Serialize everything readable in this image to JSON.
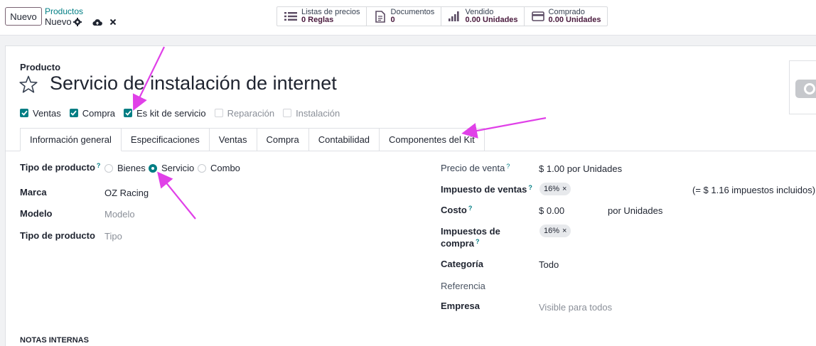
{
  "topbar": {
    "new_button": "Nuevo",
    "breadcrumb": "Productos",
    "record": "Nuevo"
  },
  "smart_buttons": [
    {
      "label": "Listas de precios",
      "value": "0  Reglas",
      "icon": "list-icon"
    },
    {
      "label": "Documentos",
      "value": "0",
      "icon": "document-icon"
    },
    {
      "label": "Vendido",
      "value": "0.00 Unidades",
      "icon": "bar-chart-icon"
    },
    {
      "label": "Comprado",
      "value": "0.00 Unidades",
      "icon": "credit-card-icon"
    }
  ],
  "sheet": {
    "label": "Producto",
    "title": "Servicio de instalación de internet"
  },
  "options": [
    {
      "label": "Ventas",
      "checked": true
    },
    {
      "label": "Compra",
      "checked": true
    },
    {
      "label": "Es kit de servicio",
      "checked": true
    },
    {
      "label": "Reparación",
      "checked": false
    },
    {
      "label": "Instalación",
      "checked": false
    }
  ],
  "tabs": [
    "Información general",
    "Especificaciones",
    "Ventas",
    "Compra",
    "Contabilidad",
    "Componentes del Kit"
  ],
  "left_fields": {
    "product_type_label": "Tipo de producto",
    "product_type_options": [
      "Bienes",
      "Servicio",
      "Combo"
    ],
    "brand_label": "Marca",
    "brand_value": "OZ Racing",
    "model_label": "Modelo",
    "model_placeholder": "Modelo",
    "type_label": "Tipo de producto",
    "type_placeholder": "Tipo"
  },
  "right_fields": {
    "sale_price_label": "Precio de venta",
    "sale_price_value": "$ 1.00 por Unidades",
    "sales_tax_label": "Impuesto de ventas",
    "sales_tax_tag": "16%",
    "tax_included_note": "(= $ 1.16 impuestos incluidos)",
    "cost_label": "Costo",
    "cost_value": "$ 0.00",
    "cost_unit": "por Unidades",
    "purchase_tax_label_1": "Impuestos de",
    "purchase_tax_label_2": "compra",
    "purchase_tax_tag": "16%",
    "category_label": "Categoría",
    "category_value": "Todo",
    "reference_label": "Referencia",
    "company_label": "Empresa",
    "company_placeholder": "Visible para todos"
  },
  "notes_heading": "NOTAS INTERNAS",
  "help_mark": "?",
  "tag_remove": "×",
  "colors": {
    "accent": "#017e84",
    "brand": "#4a1a3d",
    "annotation": "#e040e8"
  }
}
